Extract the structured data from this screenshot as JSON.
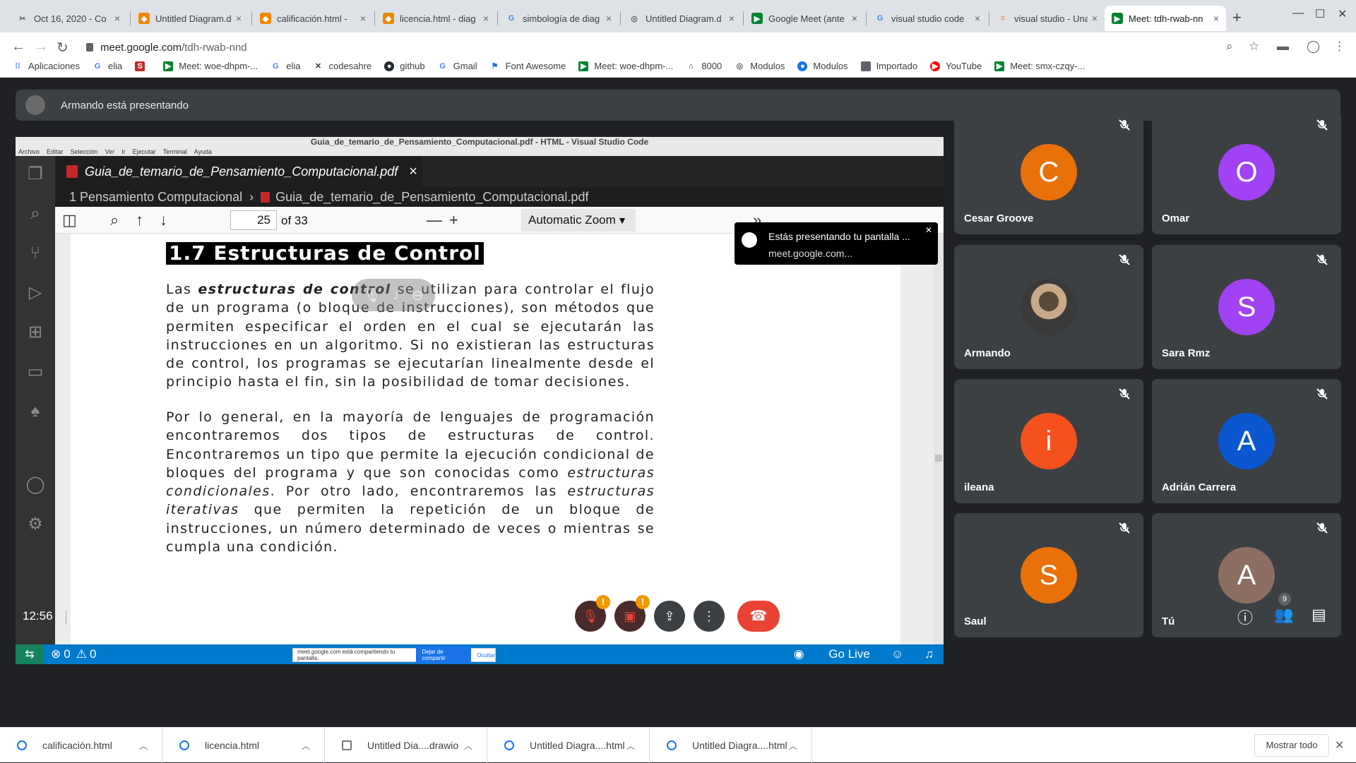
{
  "browser": {
    "tabs": [
      {
        "title": "Oct 16, 2020 - Co",
        "favicon": "scissors-icon",
        "color": "#5f6368"
      },
      {
        "title": "Untitled Diagram.d",
        "favicon": "drawio-icon",
        "color": "#f08705"
      },
      {
        "title": "calificación.html -",
        "favicon": "drawio-icon",
        "color": "#f08705"
      },
      {
        "title": "licencia.html - diag",
        "favicon": "drawio-icon",
        "color": "#f08705"
      },
      {
        "title": "simbología de diag",
        "favicon": "google-icon",
        "color": "#4285f4"
      },
      {
        "title": "Untitled Diagram.d",
        "favicon": "globe-icon",
        "color": "#5f6368"
      },
      {
        "title": "Google Meet (ante",
        "favicon": "meet-icon",
        "color": "#00832d"
      },
      {
        "title": "visual studio code",
        "favicon": "google-icon",
        "color": "#4285f4"
      },
      {
        "title": "visual studio - Una",
        "favicon": "stackoverflow-icon",
        "color": "#f48024"
      },
      {
        "title": "Meet: tdh-rwab-nn",
        "favicon": "meet-icon",
        "color": "#00832d"
      }
    ],
    "url_host": "meet.google.com",
    "url_path": "/tdh-rwab-nnd",
    "bookmarks": [
      {
        "label": "Aplicaciones",
        "icon": "apps-grid-icon",
        "color": "#4285f4"
      },
      {
        "label": "elia",
        "icon": "google-icon",
        "color": "#4285f4"
      },
      {
        "label": "",
        "icon": "sii-icon",
        "color": "#c62828"
      },
      {
        "label": "Meet: woe-dhpm-...",
        "icon": "meet-icon",
        "color": "#00832d"
      },
      {
        "label": "elia",
        "icon": "google-icon",
        "color": "#4285f4"
      },
      {
        "label": "codesahre",
        "icon": "codeshare-icon",
        "color": "#333333"
      },
      {
        "label": "github",
        "icon": "github-icon",
        "color": "#24292e"
      },
      {
        "label": "Gmail",
        "icon": "google-icon",
        "color": "#4285f4"
      },
      {
        "label": "Font Awesome",
        "icon": "flag-icon",
        "color": "#1a73e8"
      },
      {
        "label": "Meet: woe-dhpm-...",
        "icon": "meet-icon",
        "color": "#00832d"
      },
      {
        "label": "8000",
        "icon": "home-icon",
        "color": "#333333"
      },
      {
        "label": "Modulos",
        "icon": "globe-icon",
        "color": "#5f6368"
      },
      {
        "label": "Modulos",
        "icon": "circle-icon",
        "color": "#1a73e8"
      },
      {
        "label": "Importado",
        "icon": "folder-icon",
        "color": "#5f6368"
      },
      {
        "label": "YouTube",
        "icon": "youtube-icon",
        "color": "#ff0000"
      },
      {
        "label": "Meet: smx-czqy-...",
        "icon": "meet-icon",
        "color": "#00832d"
      }
    ]
  },
  "meet": {
    "presenting_text": "Armando está presentando",
    "time": "12:56",
    "meeting_code": "tdh-rwab-nnd",
    "participant_count": "9",
    "participants": [
      {
        "name": "Cesar Groove",
        "initial": "C",
        "color": "#e8710a"
      },
      {
        "name": "Omar",
        "initial": "O",
        "color": "#a142f4"
      },
      {
        "name": "Armando",
        "initial": "",
        "color": "#8a8a8a"
      },
      {
        "name": "Sara Rmz",
        "initial": "S",
        "color": "#a142f4"
      },
      {
        "name": "ileana",
        "initial": "i",
        "color": "#f4511e"
      },
      {
        "name": "Adrián Carrera",
        "initial": "A",
        "color": "#0b57d0"
      },
      {
        "name": "Saul",
        "initial": "S",
        "color": "#e8710a"
      },
      {
        "name": "Tú",
        "initial": "A",
        "color": "#8d6e63"
      }
    ],
    "toast": {
      "title": "Estás presentando tu pantalla ...",
      "subtitle": "meet.google.com..."
    }
  },
  "vscode": {
    "window_title": "Guia_de_temario_de_Pensamiento_Computacional.pdf - HTML - Visual Studio Code",
    "menu": [
      "Archivo",
      "Editar",
      "Selección",
      "Ver",
      "Ir",
      "Ejecutar",
      "Terminal",
      "Ayuda"
    ],
    "tab_label": "Guia_de_temario_de_Pensamiento_Computacional.pdf",
    "breadcrumb_folder": "1 Pensamiento Computacional",
    "breadcrumb_file": "Guia_de_temario_de_Pensamiento_Computacional.pdf",
    "page_number": "25",
    "page_total": "of 33",
    "zoom": "Automatic Zoom",
    "status_errors": "0",
    "status_warnings": "0",
    "go_live": "Go Live",
    "sharing_text": "meet.google.com está compartiendo tu pantalla.",
    "stop_sharing": "Dejar de compartir",
    "hide": "Ocultar"
  },
  "pdf": {
    "heading": "1.7 Estructuras de Control",
    "p1_pre": "Las ",
    "p1_bold": "estructuras de control",
    "p1_post": " se utilizan para controlar el flujo de un programa (o bloque de instrucciones), son métodos que permiten especificar el orden en el cual se ejecutarán las instrucciones en un algoritmo. Si no existieran las estructuras de control, los programas se ejecutarían linealmente desde el principio hasta el fin, sin la posibilidad de tomar decisiones.",
    "p2_a": "Por lo general, en la mayoría de lenguajes de programación encontraremos dos tipos de estructuras de control. Encontraremos un tipo que permite la ejecución condicional de bloques del programa y que son conocidas como ",
    "p2_i1": "estructuras condicionales",
    "p2_b": ". Por otro lado, encontraremos las ",
    "p2_i2": "estructuras iterativas",
    "p2_c": " que permiten la repetición de un bloque de instrucciones, un número determinado de veces o mientras se cumpla una condición."
  },
  "downloads": {
    "items": [
      {
        "label": "calificación.html",
        "icon": "chrome-html-icon"
      },
      {
        "label": "licencia.html",
        "icon": "chrome-html-icon"
      },
      {
        "label": "Untitled Dia....drawio",
        "icon": "file-icon"
      },
      {
        "label": "Untitled Diagra....html",
        "icon": "chrome-html-icon"
      },
      {
        "label": "Untitled Diagra....html",
        "icon": "chrome-html-icon"
      }
    ],
    "show_all": "Mostrar todo"
  }
}
